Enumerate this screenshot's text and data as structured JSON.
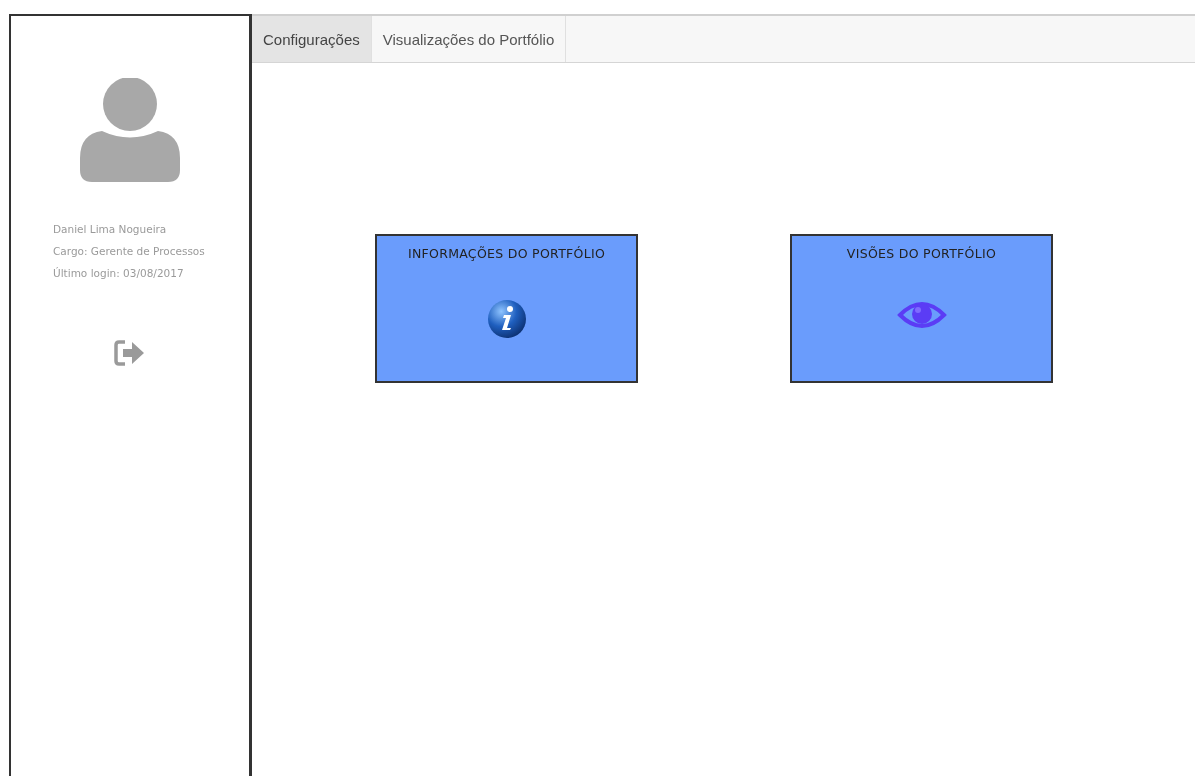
{
  "sidebar": {
    "user_name": "Daniel Lima Nogueira",
    "role": "Cargo: Gerente de Processos",
    "last_login": "Último login: 03/08/2017"
  },
  "tabs": [
    {
      "label": "Configurações",
      "selected": true
    },
    {
      "label": "Visualizações do Portfólio",
      "selected": false
    }
  ],
  "cards": [
    {
      "title": "INFORMAÇÕES DO PORTFÓLIO",
      "kind": "info"
    },
    {
      "title": "VISÕES DO PORTFÓLIO",
      "kind": "eye"
    }
  ]
}
